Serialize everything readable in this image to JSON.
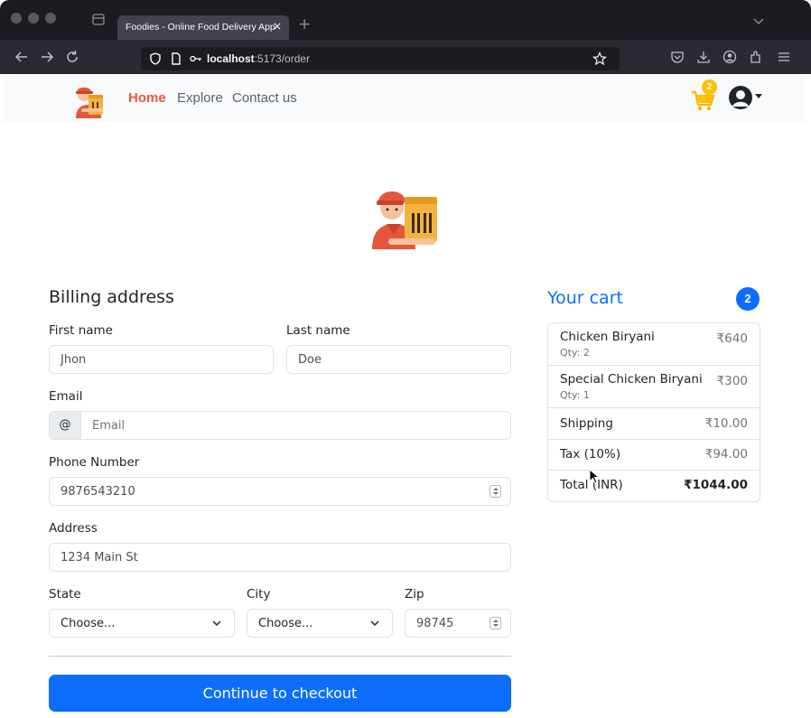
{
  "browser": {
    "tab_title": "Foodies - Online Food Delivery App",
    "tab_close": "×",
    "new_tab": "+",
    "url_host": "localhost",
    "url_path": ":5173/order",
    "toolbar_icons": [
      "pocket-icon",
      "download-icon",
      "account-icon",
      "extensions-icon",
      "menu-icon"
    ]
  },
  "navbar": {
    "links": [
      {
        "label": "Home",
        "active": true
      },
      {
        "label": "Explore",
        "active": false
      },
      {
        "label": "Contact us",
        "active": false
      }
    ],
    "cart_badge": "2",
    "colors": {
      "active": "#e9573f",
      "cart": "#ffc107"
    }
  },
  "billing": {
    "title": "Billing address",
    "first_name": {
      "label": "First name",
      "value": "Jhon"
    },
    "last_name": {
      "label": "Last name",
      "value": "Doe"
    },
    "email": {
      "label": "Email",
      "addon": "@",
      "placeholder": "Email"
    },
    "phone": {
      "label": "Phone Number",
      "value": "9876543210"
    },
    "address": {
      "label": "Address",
      "value": "1234 Main St"
    },
    "state": {
      "label": "State",
      "value": "Choose..."
    },
    "city": {
      "label": "City",
      "value": "Choose..."
    },
    "zip": {
      "label": "Zip",
      "value": "98745"
    },
    "checkout_label": "Continue to checkout",
    "accent": "#0d6efd"
  },
  "cart": {
    "title": "Your cart",
    "count": "2",
    "items": [
      {
        "name": "Chicken Biryani",
        "qty": "Qty: 2",
        "price": "₹640"
      },
      {
        "name": "Special Chicken Biryani",
        "qty": "Qty: 1",
        "price": "₹300"
      }
    ],
    "shipping": {
      "label": "Shipping",
      "value": "₹10.00"
    },
    "tax": {
      "label": "Tax (10%)",
      "value": "₹94.00"
    },
    "total": {
      "label": "Total (INR)",
      "value": "₹1044.00"
    }
  }
}
